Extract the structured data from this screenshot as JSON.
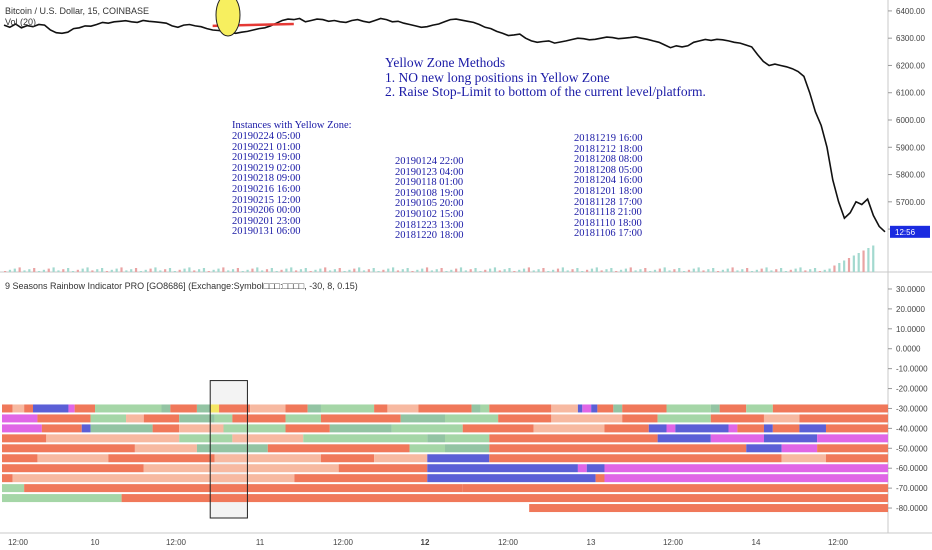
{
  "header": {
    "price_title": "Bitcoin / U.S. Dollar, 15, COINBASE",
    "vol_label": "Vol (20)",
    "indicator_title": "9 Seasons Rainbow Indicator PRO [GO8686] (Exchange:Symbol□□□:□□□□, -30, 8, 0.15)"
  },
  "notes": {
    "methods_title": "Yellow Zone Methods",
    "method_1": "1. NO new long positions in Yellow Zone",
    "method_2": "2. Raise Stop-Limit to bottom of the current level/platform.",
    "instances_title": "Instances with Yellow Zone:",
    "instances_col1": [
      "20190224 05:00",
      "20190221 01:00",
      "20190219 19:00",
      "20190219 02:00",
      "20190218 09:00",
      "20190216 16:00",
      "20190215 12:00",
      "20190206 00:00",
      "20190201 23:00",
      "20190131 06:00"
    ],
    "instances_col2": [
      "20190124 22:00",
      "20190123 04:00",
      "20190118 01:00",
      "20190108 19:00",
      "20190105 20:00",
      "20190102 15:00",
      "20181223 13:00",
      "20181220 18:00"
    ],
    "instances_col3": [
      "20181219 16:00",
      "20181212 18:00",
      "20181208 08:00",
      "20181208 05:00",
      "20181204 16:00",
      "20181201 18:00",
      "20181128 17:00",
      "20181118 21:00",
      "20181110 18:00",
      "20181106 17:00"
    ]
  },
  "chart_data": [
    {
      "type": "line",
      "title": "Bitcoin / U.S. Dollar, 15, COINBASE",
      "y_ticks": [
        6400,
        6300,
        6200,
        6100,
        6000,
        5900,
        5800,
        5700,
        5600
      ],
      "ylim": [
        5450,
        6440
      ],
      "last_price_label": "12:56",
      "x_ticks": [
        "12:00",
        "10",
        "12:00",
        "11",
        "12:00",
        "12",
        "12:00",
        "13",
        "12:00",
        "14",
        "12:00"
      ],
      "series": [
        {
          "values": [
            6348,
            6340,
            6352,
            6338,
            6346,
            6342,
            6350,
            6348,
            6330,
            6320,
            6318,
            6322,
            6335,
            6338,
            6345,
            6344,
            6350,
            6358,
            6355,
            6360,
            6362,
            6364,
            6360,
            6358,
            6365,
            6362,
            6360,
            6358,
            6355,
            6345,
            6340,
            6348,
            6350,
            6345,
            6342,
            6335,
            6330,
            6328,
            6325,
            6320,
            6318,
            6322,
            6325,
            6330,
            6335,
            6338,
            6345,
            6355,
            6365,
            6370,
            6368,
            6372,
            6360,
            6365,
            6370,
            6368,
            6362,
            6365,
            6360,
            6358,
            6365,
            6368,
            6362,
            6358,
            6365,
            6372,
            6368,
            6360,
            6362,
            6355,
            6350,
            6345,
            6340,
            6342,
            6348,
            6352,
            6360,
            6368,
            6370,
            6366,
            6362,
            6358,
            6350,
            6340,
            6335,
            6325,
            6318,
            6310,
            6312,
            6315,
            6300,
            6290,
            6285,
            6288,
            6290,
            6282,
            6286,
            6290,
            6295,
            6300,
            6298,
            6294,
            6296,
            6300,
            6304,
            6302,
            6298,
            6300,
            6302,
            6305,
            6300,
            6296,
            6290,
            6285,
            6275,
            6265,
            6272,
            6268,
            6272,
            6285,
            6290,
            6295,
            6292,
            6296,
            6294,
            6290,
            6285,
            6282,
            6275,
            6268,
            6240,
            6215,
            6200,
            6205,
            6200,
            6195,
            6188,
            6178,
            6160,
            6100,
            6030,
            5980,
            5900,
            5780,
            5700,
            5640,
            5660,
            5700,
            5690,
            5710,
            5650,
            5610,
            5590
          ]
        }
      ],
      "highlight_ellipse_center_y": 6385
    },
    {
      "type": "heatmap",
      "title": "9 Seasons Rainbow Indicator PRO [GO8686] (Exchange:Symbol□□□:□□□□, -30, 8, 0.15)",
      "y_ticks": [
        30,
        20,
        10,
        0,
        -10,
        -20,
        -30,
        -40,
        -50,
        -60,
        -70,
        -80
      ],
      "ylim": [
        -85,
        33
      ],
      "palette": {
        "r": "#f0785a",
        "p": "#f7b9a1",
        "g": "#a5d6a7",
        "t": "#93c4a3",
        "b": "#5b5fd6",
        "m": "#e066e6",
        "y": "#f5e664",
        "v": "#7e2fc9"
      },
      "rows": [
        {
          "level": -30,
          "segments": [
            [
              "r",
              0,
              0.012
            ],
            [
              "p",
              0.012,
              0.025
            ],
            [
              "r",
              0.025,
              0.035
            ],
            [
              "b",
              0.035,
              0.075
            ],
            [
              "m",
              0.075,
              0.082
            ],
            [
              "r",
              0.082,
              0.105
            ],
            [
              "g",
              0.105,
              0.18
            ],
            [
              "t",
              0.18,
              0.19
            ],
            [
              "r",
              0.19,
              0.22
            ],
            [
              "t",
              0.22,
              0.235
            ],
            [
              "y",
              0.235,
              0.245
            ],
            [
              "r",
              0.245,
              0.28
            ],
            [
              "p",
              0.28,
              0.32
            ],
            [
              "r",
              0.32,
              0.345
            ],
            [
              "t",
              0.345,
              0.36
            ],
            [
              "g",
              0.36,
              0.42
            ],
            [
              "r",
              0.42,
              0.435
            ],
            [
              "p",
              0.435,
              0.47
            ],
            [
              "r",
              0.47,
              0.53
            ],
            [
              "t",
              0.53,
              0.54
            ],
            [
              "g",
              0.54,
              0.55
            ],
            [
              "r",
              0.55,
              0.62
            ],
            [
              "p",
              0.62,
              0.65
            ],
            [
              "b",
              0.65,
              0.655
            ],
            [
              "m",
              0.655,
              0.665
            ],
            [
              "b",
              0.665,
              0.672
            ],
            [
              "r",
              0.672,
              0.69
            ],
            [
              "t",
              0.69,
              0.7
            ],
            [
              "r",
              0.7,
              0.75
            ],
            [
              "g",
              0.75,
              0.8
            ],
            [
              "t",
              0.8,
              0.81
            ],
            [
              "r",
              0.81,
              0.84
            ],
            [
              "g",
              0.84,
              0.87
            ],
            [
              "r",
              0.87,
              1.0
            ]
          ]
        },
        {
          "level": -35,
          "segments": [
            [
              "m",
              0,
              0.04
            ],
            [
              "r",
              0.04,
              0.1
            ],
            [
              "g",
              0.1,
              0.14
            ],
            [
              "p",
              0.14,
              0.16
            ],
            [
              "r",
              0.16,
              0.2
            ],
            [
              "t",
              0.2,
              0.24
            ],
            [
              "g",
              0.24,
              0.26
            ],
            [
              "r",
              0.26,
              0.32
            ],
            [
              "g",
              0.32,
              0.36
            ],
            [
              "r",
              0.36,
              0.45
            ],
            [
              "t",
              0.45,
              0.5
            ],
            [
              "g",
              0.5,
              0.56
            ],
            [
              "r",
              0.56,
              0.62
            ],
            [
              "p",
              0.62,
              0.7
            ],
            [
              "r",
              0.7,
              0.74
            ],
            [
              "g",
              0.74,
              0.8
            ],
            [
              "r",
              0.8,
              0.86
            ],
            [
              "p",
              0.86,
              0.9
            ],
            [
              "r",
              0.9,
              1.0
            ]
          ]
        },
        {
          "level": -40,
          "segments": [
            [
              "m",
              0,
              0.045
            ],
            [
              "r",
              0.045,
              0.09
            ],
            [
              "b",
              0.09,
              0.1
            ],
            [
              "t",
              0.1,
              0.17
            ],
            [
              "r",
              0.17,
              0.2
            ],
            [
              "p",
              0.2,
              0.25
            ],
            [
              "g",
              0.25,
              0.32
            ],
            [
              "r",
              0.32,
              0.37
            ],
            [
              "t",
              0.37,
              0.44
            ],
            [
              "g",
              0.44,
              0.52
            ],
            [
              "r",
              0.52,
              0.6
            ],
            [
              "p",
              0.6,
              0.68
            ],
            [
              "r",
              0.68,
              0.73
            ],
            [
              "b",
              0.73,
              0.75
            ],
            [
              "m",
              0.75,
              0.76
            ],
            [
              "b",
              0.76,
              0.82
            ],
            [
              "m",
              0.82,
              0.83
            ],
            [
              "r",
              0.83,
              0.86
            ],
            [
              "b",
              0.86,
              0.87
            ],
            [
              "r",
              0.87,
              0.9
            ],
            [
              "b",
              0.9,
              0.93
            ],
            [
              "r",
              0.93,
              1.0
            ]
          ]
        },
        {
          "level": -45,
          "segments": [
            [
              "r",
              0,
              0.05
            ],
            [
              "p",
              0.05,
              0.2
            ],
            [
              "g",
              0.2,
              0.26
            ],
            [
              "p",
              0.26,
              0.34
            ],
            [
              "g",
              0.34,
              0.48
            ],
            [
              "t",
              0.48,
              0.5
            ],
            [
              "g",
              0.5,
              0.55
            ],
            [
              "r",
              0.55,
              0.74
            ],
            [
              "b",
              0.74,
              0.8
            ],
            [
              "m",
              0.8,
              0.86
            ],
            [
              "b",
              0.86,
              0.92
            ],
            [
              "m",
              0.92,
              1.0
            ]
          ]
        },
        {
          "level": -50,
          "segments": [
            [
              "r",
              0,
              0.15
            ],
            [
              "p",
              0.15,
              0.22
            ],
            [
              "t",
              0.22,
              0.3
            ],
            [
              "r",
              0.3,
              0.46
            ],
            [
              "g",
              0.46,
              0.5
            ],
            [
              "t",
              0.5,
              0.55
            ],
            [
              "r",
              0.55,
              0.84
            ],
            [
              "b",
              0.84,
              0.88
            ],
            [
              "m",
              0.88,
              0.92
            ],
            [
              "r",
              0.92,
              1.0
            ]
          ]
        },
        {
          "level": -55,
          "segments": [
            [
              "r",
              0,
              0.04
            ],
            [
              "p",
              0.04,
              0.12
            ],
            [
              "r",
              0.12,
              0.24
            ],
            [
              "p",
              0.24,
              0.36
            ],
            [
              "r",
              0.36,
              0.42
            ],
            [
              "p",
              0.42,
              0.48
            ],
            [
              "b",
              0.48,
              0.55
            ],
            [
              "r",
              0.55,
              0.88
            ],
            [
              "p",
              0.88,
              0.93
            ],
            [
              "r",
              0.93,
              1.0
            ]
          ]
        },
        {
          "level": -60,
          "segments": [
            [
              "r",
              0,
              0.16
            ],
            [
              "p",
              0.16,
              0.38
            ],
            [
              "r",
              0.38,
              0.48
            ],
            [
              "b",
              0.48,
              0.65
            ],
            [
              "m",
              0.65,
              0.66
            ],
            [
              "b",
              0.66,
              0.68
            ],
            [
              "m",
              0.68,
              1.0
            ]
          ]
        },
        {
          "level": -65,
          "segments": [
            [
              "r",
              0,
              0.012
            ],
            [
              "p",
              0.012,
              0.33
            ],
            [
              "r",
              0.33,
              0.48
            ],
            [
              "b",
              0.48,
              0.67
            ],
            [
              "r",
              0.67,
              0.68
            ],
            [
              "m",
              0.68,
              1.0
            ]
          ]
        },
        {
          "level": -70,
          "segments": [
            [
              "g",
              0,
              0.025
            ],
            [
              "r",
              0.025,
              0.52
            ],
            [
              "r",
              0.52,
              1.0
            ]
          ]
        },
        {
          "level": -75,
          "segments": [
            [
              "g",
              0,
              0.135
            ],
            [
              "r",
              0.135,
              1.0
            ]
          ]
        },
        {
          "level": -80,
          "segments": [
            [
              "r",
              0.595,
              1.0
            ]
          ]
        }
      ],
      "highlight_box": {
        "x_start": 0.235,
        "x_end": 0.277,
        "y_top": -16,
        "y_bottom": -85
      }
    }
  ]
}
